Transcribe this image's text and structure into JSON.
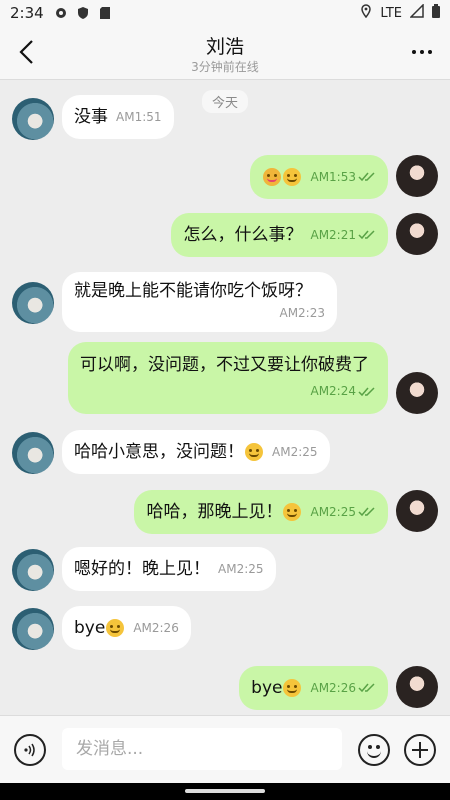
{
  "status_bar": {
    "time": "2:34",
    "network": "LTE"
  },
  "header": {
    "title": "刘浩",
    "subtitle": "3分钟前在线"
  },
  "chat": {
    "date_label": "今天"
  },
  "messages": [
    {
      "side": "left",
      "text": "没事",
      "emoji": "",
      "time": "AM1:51"
    },
    {
      "side": "right",
      "text": "",
      "emoji": "😜😁",
      "time": "AM1:53"
    },
    {
      "side": "right",
      "text": "怎么，什么事？",
      "emoji": "",
      "time": "AM2:21"
    },
    {
      "side": "left",
      "text": "就是晚上能不能请你吃个饭呀？",
      "emoji": "",
      "time": "AM2:23"
    },
    {
      "side": "right",
      "text": "可以啊，没问题，不过又要让你破费了",
      "emoji": "",
      "time": "AM2:24"
    },
    {
      "side": "left",
      "text": "哈哈小意思，没问题！",
      "emoji": "😁",
      "time": "AM2:25"
    },
    {
      "side": "right",
      "text": "哈哈，那晚上见！",
      "emoji": "😊",
      "time": "AM2:25"
    },
    {
      "side": "left",
      "text": "嗯好的！晚上见！",
      "emoji": "",
      "time": "AM2:25"
    },
    {
      "side": "left",
      "text": "bye",
      "emoji": "😉",
      "time": "AM2:26"
    },
    {
      "side": "right",
      "text": "bye",
      "emoji": "😊",
      "time": "AM2:26"
    }
  ],
  "input": {
    "placeholder": "发消息..."
  },
  "colors": {
    "self_bubble": "#c9f6a7",
    "other_bubble": "#ffffff",
    "read_check": "#59a246"
  }
}
